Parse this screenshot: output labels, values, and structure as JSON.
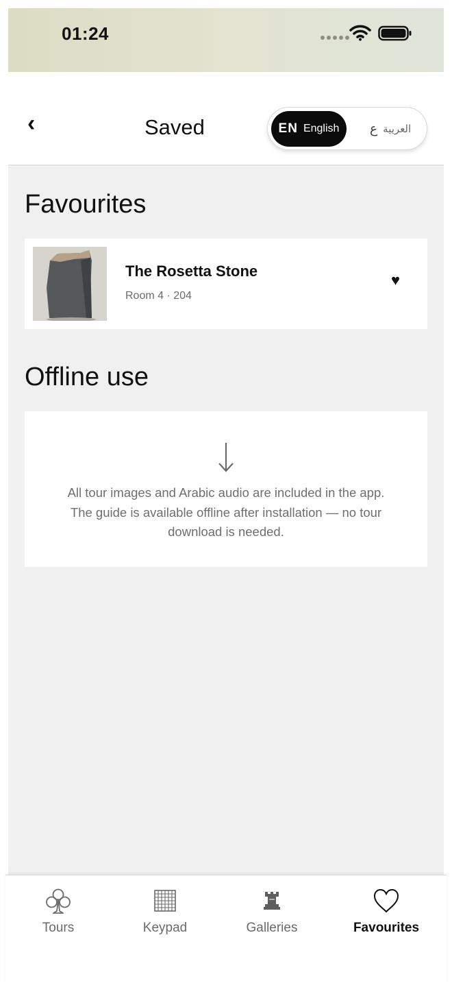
{
  "status_bar": {
    "time": "01:24",
    "icons": [
      "signal-dots-icon",
      "wifi-icon",
      "battery-icon"
    ]
  },
  "header": {
    "back_icon": "‹",
    "title": "Saved",
    "language": {
      "selected": "en",
      "en_code": "EN",
      "en_name": "English",
      "ar_code": "ع",
      "ar_name": "العربية"
    }
  },
  "favourites": {
    "title": "Favourites",
    "items": [
      {
        "title": "The Rosetta Stone",
        "meta": "Room 4 · 204",
        "image": "rosetta-stone-thumbnail",
        "favourited": true,
        "heart": "♥"
      }
    ]
  },
  "offline": {
    "title": "Offline use",
    "icon": "down-arrow-icon",
    "message": "All tour images and Arabic audio are included in the app. The guide is available offline after installation — no tour download is needed."
  },
  "tabbar": {
    "active": "favourites",
    "tabs": [
      {
        "key": "tours",
        "label": "Tours",
        "icon": "club-icon"
      },
      {
        "key": "keypad",
        "label": "Keypad",
        "icon": "grid-icon"
      },
      {
        "key": "galleries",
        "label": "Galleries",
        "icon": "rook-icon"
      },
      {
        "key": "favourites",
        "label": "Favourites",
        "icon": "heart-outline-icon"
      }
    ]
  },
  "colors": {
    "status_bar_bg": "#e0e2d0",
    "content_bg": "#f0f0f0",
    "active_toggle_bg": "#0b0b0b",
    "muted_text": "#6e6e6e"
  }
}
